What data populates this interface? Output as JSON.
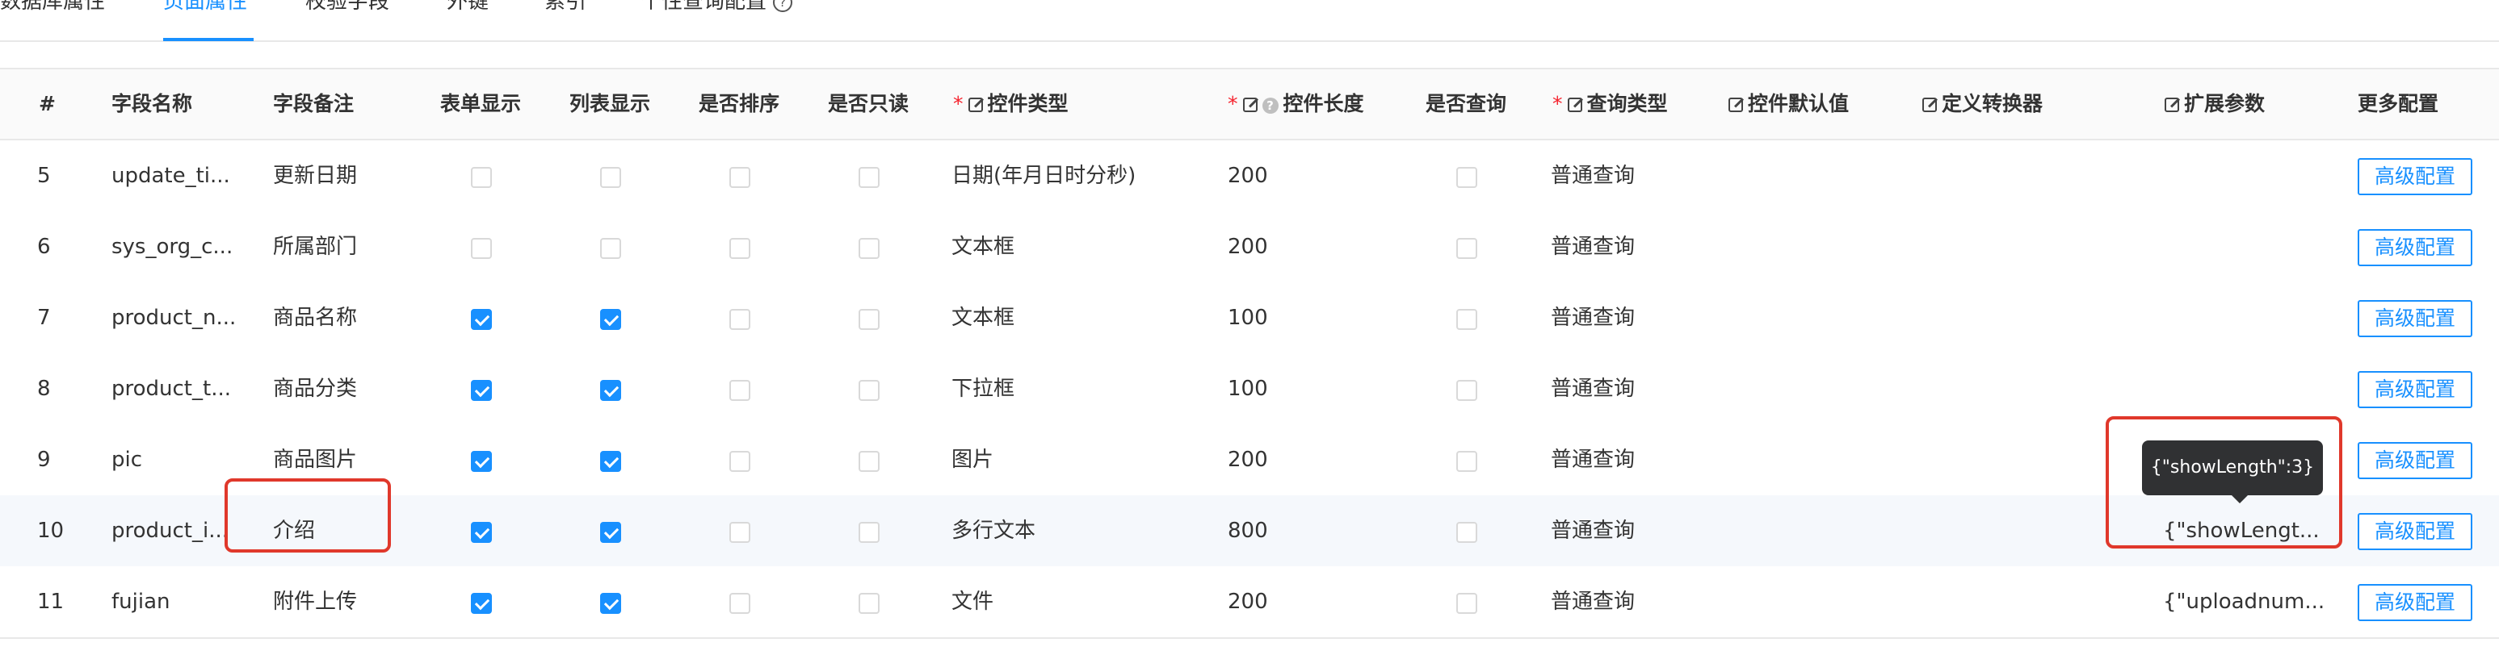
{
  "tabs": [
    {
      "label": "数据库属性"
    },
    {
      "label": "页面属性"
    },
    {
      "label": "校验字段"
    },
    {
      "label": "外键"
    },
    {
      "label": "索引"
    },
    {
      "label": "个性查询配置"
    }
  ],
  "active_tab": "页面属性",
  "table": {
    "headers": {
      "index": "#",
      "field_name": "字段名称",
      "field_remark": "字段备注",
      "form_show": "表单显示",
      "list_show": "列表显示",
      "sortable": "是否排序",
      "readonly": "是否只读",
      "control_type": "控件类型",
      "control_length": "控件长度",
      "queryable": "是否查询",
      "query_type": "查询类型",
      "default_value": "控件默认值",
      "converter": "定义转换器",
      "ext_params": "扩展参数",
      "more_config": "更多配置"
    },
    "required_mark": "*",
    "rows": [
      {
        "index": "5",
        "field_name": "update_ti...",
        "remark": "更新日期",
        "control_type": "日期(年月日时分秒)",
        "length": "200",
        "query_type": "普通查询",
        "ext": "",
        "button": "高级配置"
      },
      {
        "index": "6",
        "field_name": "sys_org_c...",
        "remark": "所属部门",
        "control_type": "文本框",
        "length": "200",
        "query_type": "普通查询",
        "ext": "",
        "button": "高级配置"
      },
      {
        "index": "7",
        "field_name": "product_n...",
        "remark": "商品名称",
        "control_type": "文本框",
        "length": "100",
        "query_type": "普通查询",
        "ext": "",
        "button": "高级配置"
      },
      {
        "index": "8",
        "field_name": "product_t...",
        "remark": "商品分类",
        "control_type": "下拉框",
        "length": "100",
        "query_type": "普通查询",
        "ext": "",
        "button": "高级配置"
      },
      {
        "index": "9",
        "field_name": "pic",
        "remark": "商品图片",
        "control_type": "图片",
        "length": "200",
        "query_type": "普通查询",
        "ext": "",
        "button": "高级配置"
      },
      {
        "index": "10",
        "field_name": "product_i...",
        "remark": "介绍",
        "control_type": "多行文本",
        "length": "800",
        "query_type": "普通查询",
        "ext": "{\"showLengt...",
        "button": "高级配置"
      },
      {
        "index": "11",
        "field_name": "fujian",
        "remark": "附件上传",
        "control_type": "文件",
        "length": "200",
        "query_type": "普通查询",
        "ext": "{\"uploadnum...",
        "button": "高级配置"
      }
    ],
    "row_checks": [
      {
        "form": false,
        "list": false,
        "sort": false,
        "readonly": false,
        "query": false
      },
      {
        "form": false,
        "list": false,
        "sort": false,
        "readonly": false,
        "query": false
      },
      {
        "form": true,
        "list": true,
        "sort": false,
        "readonly": false,
        "query": false
      },
      {
        "form": true,
        "list": true,
        "sort": false,
        "readonly": false,
        "query": false
      },
      {
        "form": true,
        "list": true,
        "sort": false,
        "readonly": false,
        "query": false
      },
      {
        "form": true,
        "list": true,
        "sort": false,
        "readonly": false,
        "query": false
      },
      {
        "form": true,
        "list": true,
        "sort": false,
        "readonly": false,
        "query": false
      }
    ]
  },
  "tooltip": {
    "text": "{\"showLength\":3}"
  },
  "colors": {
    "accent": "#1890ff",
    "highlight": "#e0382b",
    "required": "#f5222d",
    "tooltip_bg": "#303133"
  }
}
